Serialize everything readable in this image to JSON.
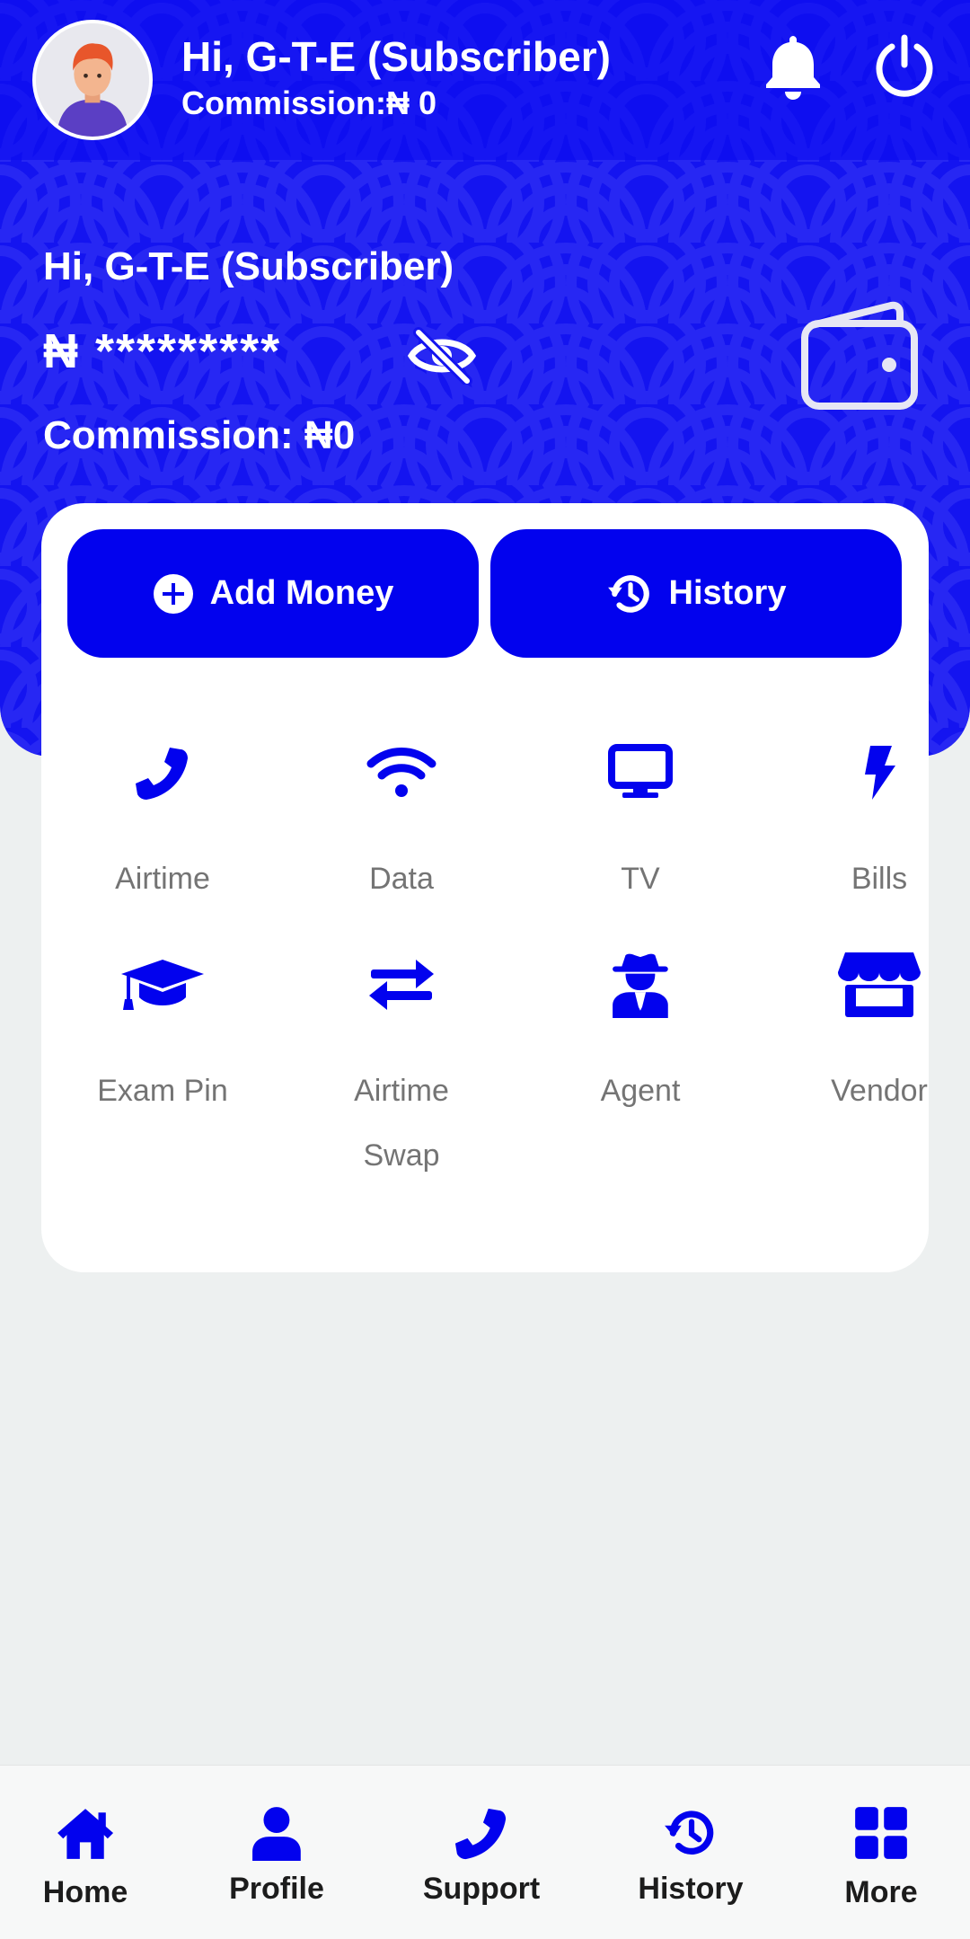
{
  "header": {
    "greeting": "Hi, G-T-E (Subscriber)",
    "commission": "Commission:₦ 0",
    "avatar_icon": "user-avatar-icon",
    "bell_icon": "bell-icon",
    "power_icon": "power-icon"
  },
  "balance_card": {
    "greeting": "Hi, G-T-E (Subscriber)",
    "balance_masked": "₦ *********",
    "commission": "Commission: ₦0",
    "eye_icon": "eye-slash-icon",
    "wallet_icon": "wallet-icon"
  },
  "actions": {
    "add_money": "Add Money",
    "history": "History"
  },
  "services": [
    {
      "label": "Airtime",
      "icon": "phone-icon"
    },
    {
      "label": "Data",
      "icon": "wifi-icon"
    },
    {
      "label": "TV",
      "icon": "tv-icon"
    },
    {
      "label": "Bills",
      "icon": "bolt-icon"
    },
    {
      "label": "Exam Pin",
      "icon": "graduation-cap-icon"
    },
    {
      "label": "Airtime Swap",
      "icon": "swap-arrows-icon"
    },
    {
      "label": "Agent",
      "icon": "agent-icon"
    },
    {
      "label": "Vendor",
      "icon": "store-icon"
    }
  ],
  "bottom_nav": [
    {
      "label": "Home",
      "icon": "home-icon"
    },
    {
      "label": "Profile",
      "icon": "user-icon"
    },
    {
      "label": "Support",
      "icon": "phone-icon"
    },
    {
      "label": "History",
      "icon": "history-icon"
    },
    {
      "label": "More",
      "icon": "grid-icon"
    }
  ],
  "colors": {
    "primary": "#0202ee",
    "hero_bg": "#1414f0",
    "page_bg": "#edf0f0",
    "label_gray": "#747474"
  }
}
